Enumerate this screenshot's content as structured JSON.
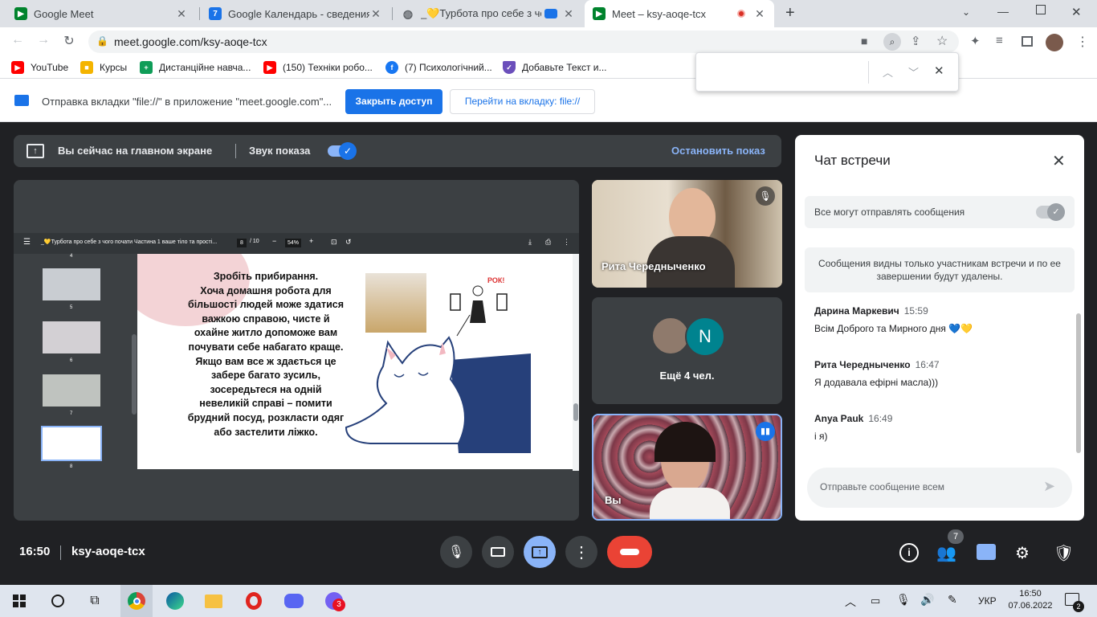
{
  "tabs": [
    {
      "title": "Google Meet"
    },
    {
      "title": "Google Календарь - сведения о"
    },
    {
      "title": "_💛Турбота про себе з чо"
    },
    {
      "title": "Meet – ksy-aoqe-tcx"
    }
  ],
  "url": "meet.google.com/ksy-aoqe-tcx",
  "bookmarks": [
    {
      "label": "YouTube"
    },
    {
      "label": "Курсы"
    },
    {
      "label": "Дистанційне навча..."
    },
    {
      "label": "(150) Техніки робо..."
    },
    {
      "label": "(7) Психологічний..."
    },
    {
      "label": "Добавьте Текст и..."
    }
  ],
  "infobar": {
    "message": "Отправка вкладки \"file://\" в приложение \"meet.google.com\"...",
    "close_access": "Закрыть доступ",
    "goto_tab": "Перейти на вкладку: file://"
  },
  "presenting": {
    "label": "Вы сейчас на главном экране",
    "sound": "Звук показа",
    "stop": "Остановить показ"
  },
  "pdf": {
    "title": "_💛Турбота про себе з чого почати Частина 1 ваше тіло та прості...",
    "page": "8",
    "pages": "/ 10",
    "zoom": "54%",
    "thumbs": [
      {
        "num": "4"
      },
      {
        "num": "5"
      },
      {
        "num": "6"
      },
      {
        "num": "7"
      },
      {
        "num": "8"
      }
    ],
    "slide_text": [
      "Зробіть прибирання.",
      "Хоча домашня робота для",
      "більшості людей може здатися",
      "важкою справою, чисте й",
      "охайне житло допоможе вам",
      "почувати себе набагато краще.",
      "Якщо вам все ж здається це",
      "забере багато зусиль,",
      "зосередьтеся на одній",
      "невеликій справі – помити",
      "брудний посуд, розкласти одяг",
      "або застелити ліжко."
    ],
    "sticker": "РОК!"
  },
  "tiles": {
    "rita": "Рита Чередныченко",
    "more_initial": "N",
    "more": "Ещё 4 чел.",
    "me": "Вы"
  },
  "chat": {
    "title": "Чат встречи",
    "allow": "Все могут отправлять сообщения",
    "notice": "Сообщения видны только участникам встречи и по ее завершении будут удалены.",
    "messages": [
      {
        "name": "Дарина Маркевич",
        "time": "15:59",
        "text": "Всім Доброго та Мирного дня 💙💛"
      },
      {
        "name": "Рита Чередныченко",
        "time": "16:47",
        "text": "Я додавала ефірні масла)))"
      },
      {
        "name": "Anya Pauk",
        "time": "16:49",
        "text": "і я)"
      }
    ],
    "placeholder": "Отправьте сообщение всем"
  },
  "bottom": {
    "time": "16:50",
    "code": "ksy-aoqe-tcx",
    "people_count": "7"
  },
  "taskbar": {
    "lang": "УКР",
    "time": "16:50",
    "date": "07.06.2022",
    "viber_badge": "3",
    "notif": "2"
  },
  "colors": {
    "accent": "#1a73e8",
    "meet_bg": "#202124",
    "end_call": "#ea4335",
    "present_active": "#8ab4f8"
  }
}
